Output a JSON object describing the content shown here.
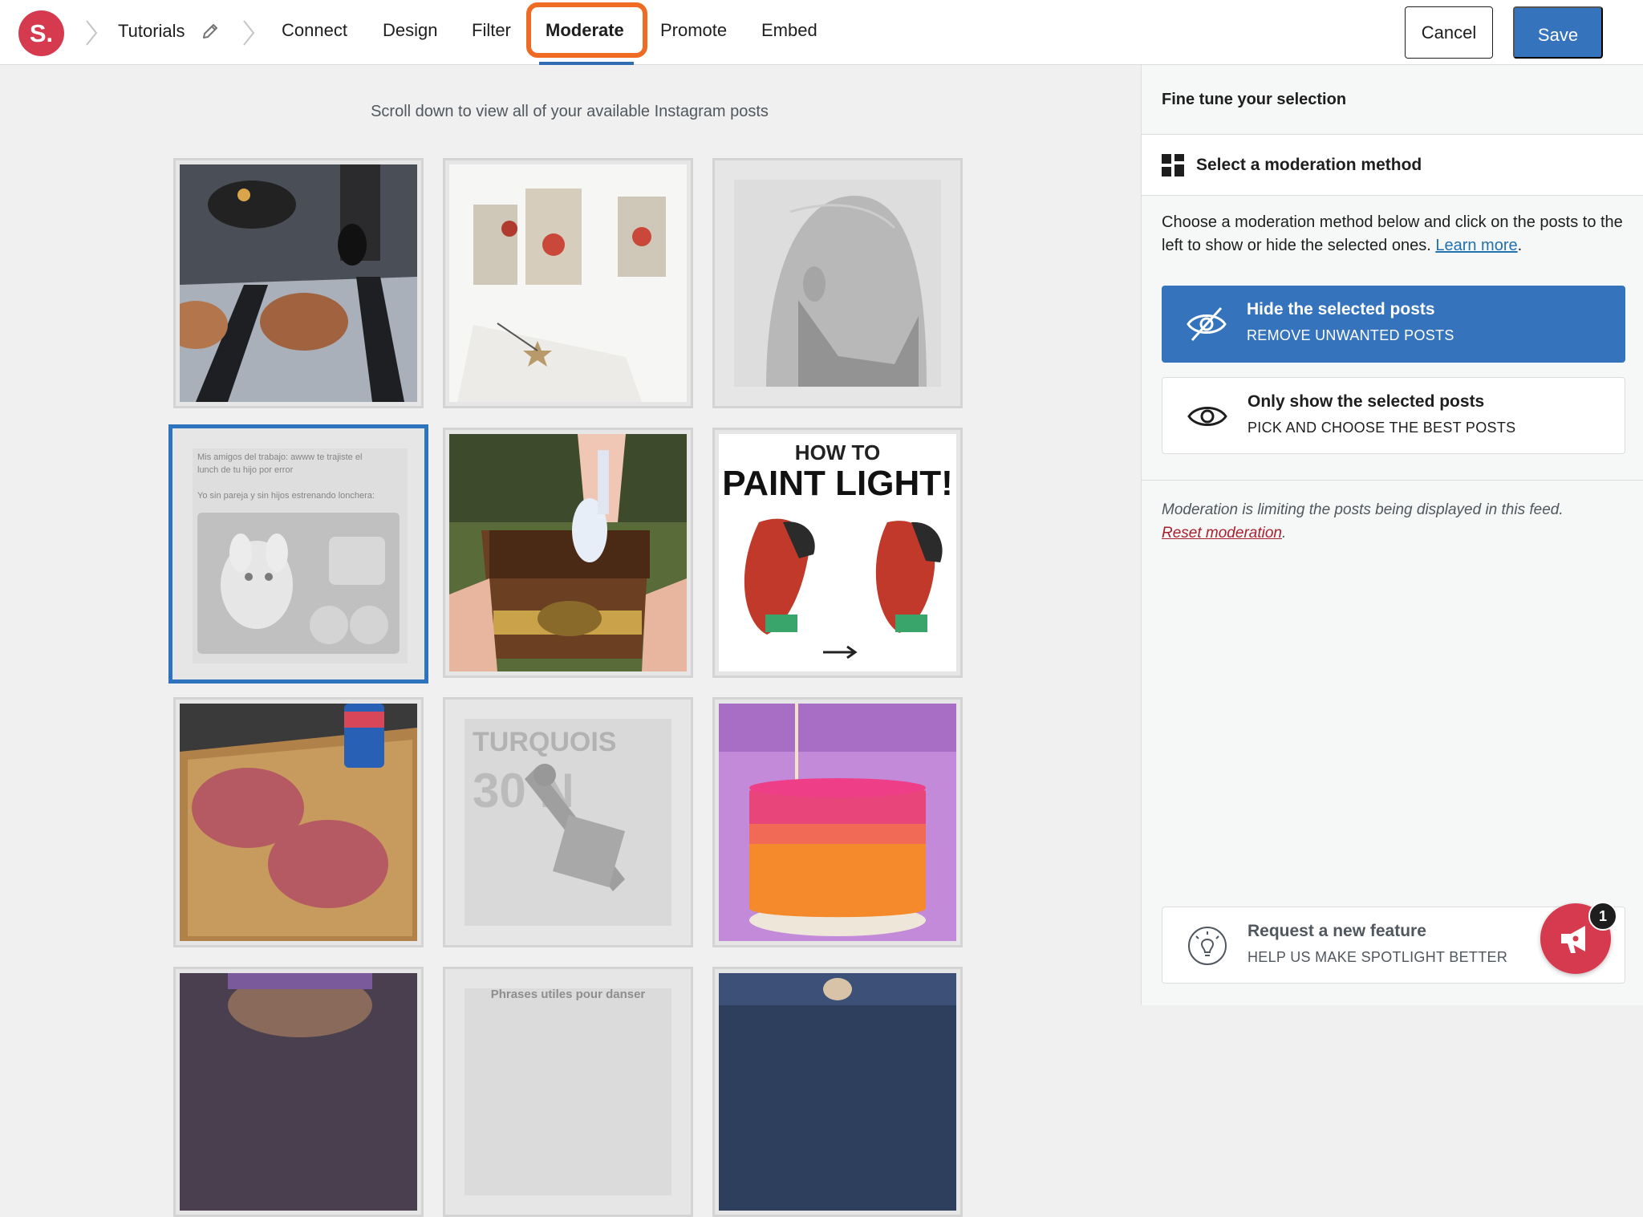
{
  "logo": {
    "text": "S."
  },
  "breadcrumb": {
    "feed_name": "Tutorials"
  },
  "nav": {
    "items": [
      {
        "label": "Connect"
      },
      {
        "label": "Design"
      },
      {
        "label": "Filter"
      },
      {
        "label": "Moderate"
      },
      {
        "label": "Promote"
      },
      {
        "label": "Embed"
      }
    ],
    "active": "Moderate"
  },
  "toolbar": {
    "cancel_label": "Cancel",
    "save_label": "Save"
  },
  "main": {
    "hint": "Scroll down to view all of your available Instagram posts",
    "posts": [
      {
        "state": "shown"
      },
      {
        "state": "shown"
      },
      {
        "state": "hidden"
      },
      {
        "state": "hidden",
        "selected": true,
        "text_line1": "Mis amigos del trabajo: awww te trajiste el",
        "text_line2": "lunch de tu hijo por error",
        "text_line3": "Yo sin pareja y sin hijos estrenando lonchera:"
      },
      {
        "state": "shown"
      },
      {
        "state": "shown",
        "text_line1": "HOW TO",
        "text_line2": "PAINT LIGHT!"
      },
      {
        "state": "shown"
      },
      {
        "state": "hidden",
        "text_line1": "TURQUOIS",
        "text_line2": "30 N"
      },
      {
        "state": "shown"
      },
      {
        "state": "shown"
      },
      {
        "state": "hidden",
        "text_line1": "Phrases utiles pour danser"
      },
      {
        "state": "shown"
      }
    ]
  },
  "panel": {
    "header": "Fine tune your selection",
    "method_title": "Select a moderation method",
    "description": "Choose a moderation method below and click on the posts to the left to show or hide the selected ones.",
    "learn_more": "Learn more",
    "options": [
      {
        "title": "Hide the selected posts",
        "subtitle": "REMOVE UNWANTED POSTS",
        "icon": "eye-slash-icon",
        "active": true
      },
      {
        "title": "Only show the selected posts",
        "subtitle": "PICK AND CHOOSE THE BEST POSTS",
        "icon": "eye-icon",
        "active": false
      }
    ],
    "note": "Moderation is limiting the posts being displayed in this feed.",
    "reset_link": "Reset moderation",
    "feature": {
      "title": "Request a new feature",
      "subtitle": "HELP US MAKE SPOTLIGHT BETTER",
      "icon": "lightbulb-icon"
    },
    "fab_badge": "1"
  },
  "colors": {
    "brand": "#d63a4f",
    "accent": "#3574bd",
    "highlight": "#ef6a22",
    "selected_border": "#2e73be"
  }
}
